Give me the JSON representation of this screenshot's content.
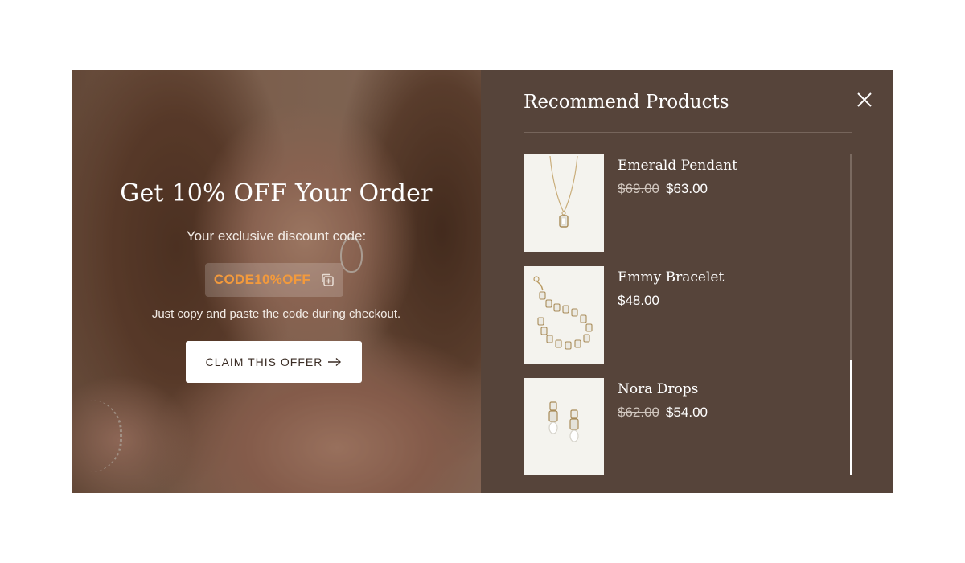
{
  "promo": {
    "title": "Get 10% OFF Your Order",
    "subtitle": "Your exclusive discount code:",
    "code": "CODE10%OFF",
    "note": "Just copy and paste the code during checkout.",
    "button_label": "CLAIM THIS OFFER"
  },
  "products_panel": {
    "title": "Recommend Products",
    "items": [
      {
        "name": "Emerald Pendant",
        "old_price": "$69.00",
        "price": "$63.00",
        "icon": "pendant-necklace"
      },
      {
        "name": "Emmy Bracelet",
        "old_price": "",
        "price": "$48.00",
        "icon": "crystal-bracelet"
      },
      {
        "name": "Nora Drops",
        "old_price": "$62.00",
        "price": "$54.00",
        "icon": "pearl-drop-earrings"
      }
    ]
  },
  "colors": {
    "panel_bg": "#56443a",
    "code_accent": "#f39a3c",
    "button_bg": "#ffffff",
    "thumb_bg": "#f4f3ee"
  }
}
